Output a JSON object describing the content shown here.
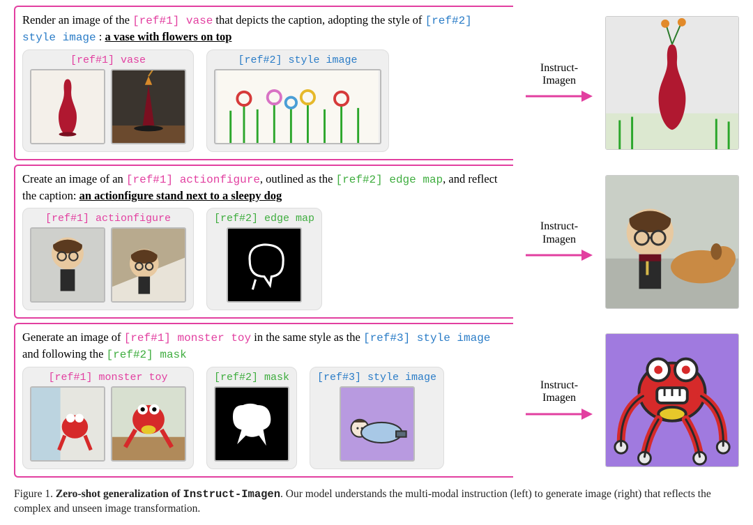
{
  "examples": [
    {
      "instruction": {
        "pre": "Render an image of the ",
        "ref1": "[ref#1] vase",
        "mid1": " that depicts the caption, adopting the style of ",
        "ref2": "[ref#2] style image",
        "mid2": " : ",
        "caption": "a vase with flowers on top"
      },
      "refs": [
        {
          "label": "[ref#1] vase",
          "color": "pink"
        },
        {
          "label": "[ref#2] style image",
          "color": "blue"
        }
      ]
    },
    {
      "instruction": {
        "pre": "Create an image of an ",
        "ref1": "[ref#1] actionfigure",
        "mid1": ", outlined as the ",
        "ref2": "[ref#2] edge map",
        "mid2": ", and reflect the caption: ",
        "caption": "an actionfigure stand next to a sleepy dog"
      },
      "refs": [
        {
          "label": "[ref#1] actionfigure",
          "color": "pink"
        },
        {
          "label": "[ref#2] edge map",
          "color": "green"
        }
      ]
    },
    {
      "instruction": {
        "pre": "Generate an image of ",
        "ref1": "[ref#1] monster toy",
        "mid1": " in the same style as the ",
        "ref3": "[ref#3] style image",
        "mid2": " and following the ",
        "ref2": "[ref#2] mask",
        "caption": ""
      },
      "refs": [
        {
          "label": "[ref#1] monster toy",
          "color": "pink"
        },
        {
          "label": "[ref#2] mask",
          "color": "green"
        },
        {
          "label": "[ref#3] style image",
          "color": "blue"
        }
      ]
    }
  ],
  "arrow_label_line1": "Instruct-",
  "arrow_label_line2": "Imagen",
  "caption": {
    "fignum": "Figure 1.",
    "title_bold": "Zero-shot generalization of ",
    "title_mono": "Instruct-Imagen",
    "period": ". ",
    "rest": "Our model understands the multi-modal instruction (left) to generate image (right) that reflects the complex and unseen image transformation."
  }
}
